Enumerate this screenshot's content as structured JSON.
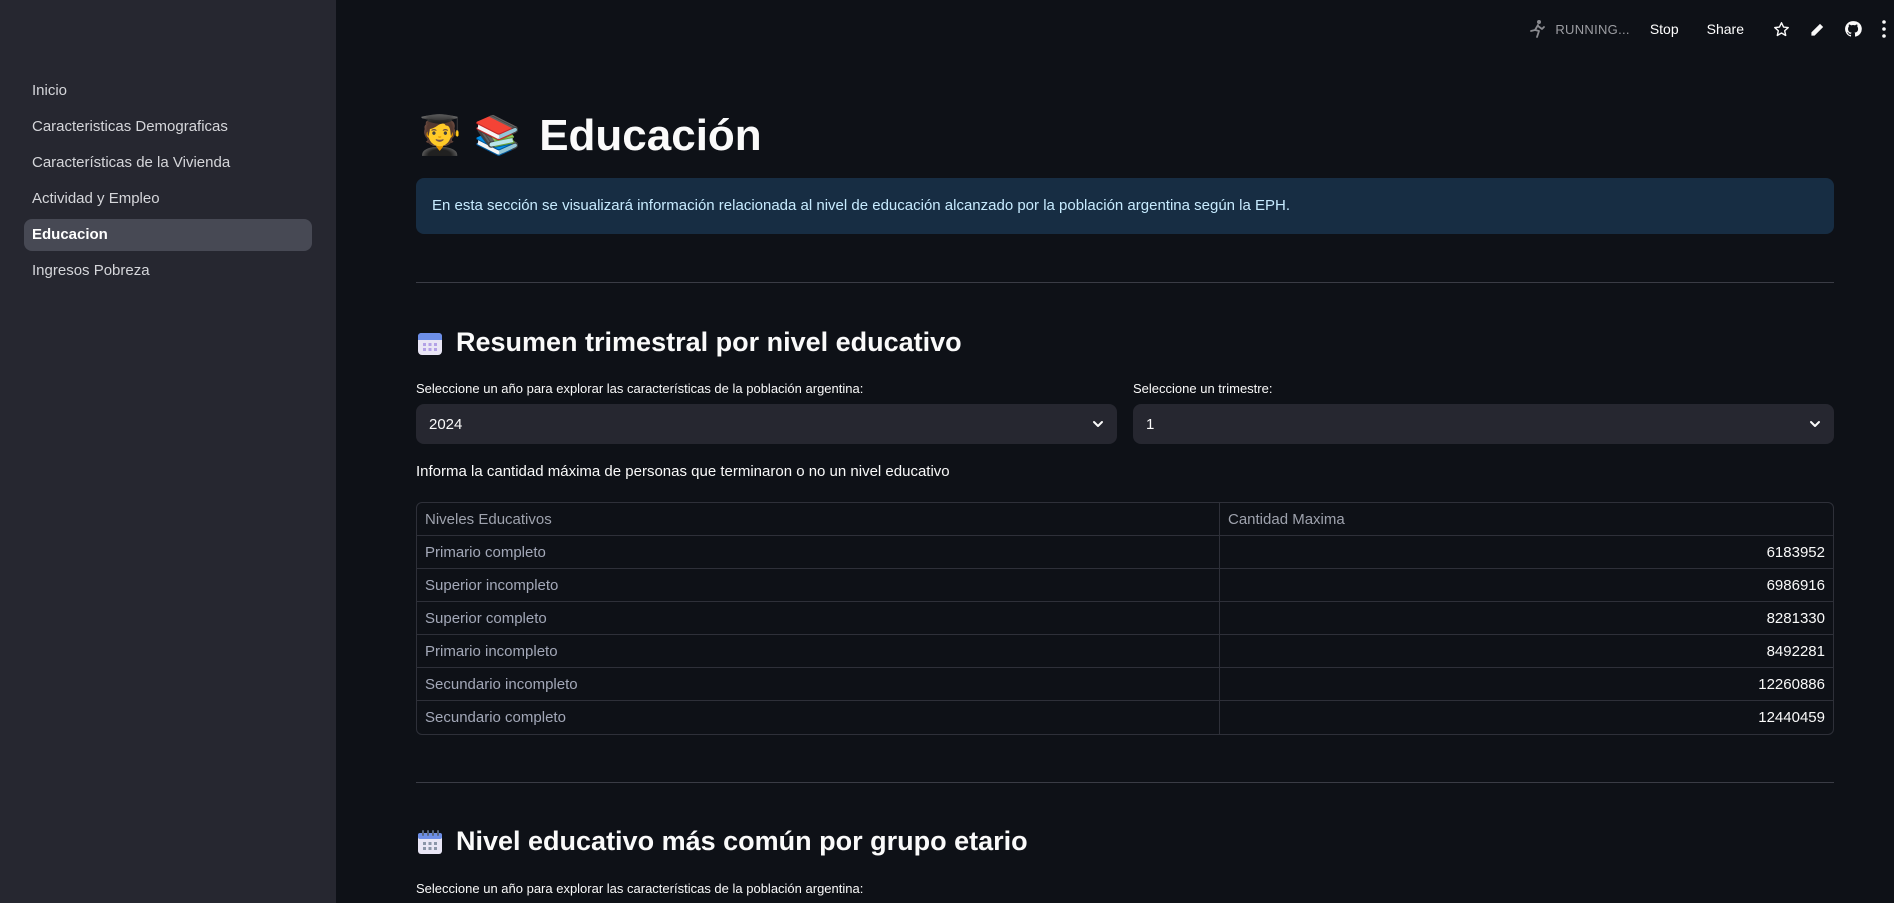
{
  "sidebar": {
    "items": [
      {
        "label": "Inicio"
      },
      {
        "label": "Caracteristicas Demograficas"
      },
      {
        "label": "Características de la Vivienda"
      },
      {
        "label": "Actividad y Empleo"
      },
      {
        "label": "Educacion",
        "active": true
      },
      {
        "label": "Ingresos Pobreza"
      }
    ]
  },
  "toolbar": {
    "status": "RUNNING...",
    "stop_label": "Stop",
    "share_label": "Share",
    "icons": [
      "running-man-icon",
      "star-icon",
      "pencil-icon",
      "github-icon",
      "more-vertical-icon"
    ]
  },
  "page": {
    "title": "Educación",
    "title_emojis": "🧑‍🎓 📚",
    "info": "En esta sección se visualizará información relacionada al nivel de educación alcanzado por la población argentina según la EPH."
  },
  "section1": {
    "title": "Resumen trimestral por nivel educativo",
    "year_label": "Seleccione un año para explorar las características de la población argentina:",
    "year_value": "2024",
    "quarter_label": "Seleccione un trimestre:",
    "quarter_value": "1",
    "caption": "Informa la cantidad máxima de personas que terminaron o no un nivel educativo",
    "table": {
      "headers": [
        "Niveles Educativos",
        "Cantidad Maxima"
      ],
      "rows": [
        [
          "Primario completo",
          "6183952"
        ],
        [
          "Superior incompleto",
          "6986916"
        ],
        [
          "Superior completo",
          "8281330"
        ],
        [
          "Primario incompleto",
          "8492281"
        ],
        [
          "Secundario incompleto",
          "12260886"
        ],
        [
          "Secundario completo",
          "12440459"
        ]
      ]
    }
  },
  "section2": {
    "title": "Nivel educativo más común por grupo etario",
    "year_label": "Seleccione un año para explorar las características de la población argentina:"
  },
  "colors": {
    "background": "#0e1117",
    "sidebar": "#262730",
    "info_bg": "#172d43",
    "info_text": "#c7ebff"
  }
}
